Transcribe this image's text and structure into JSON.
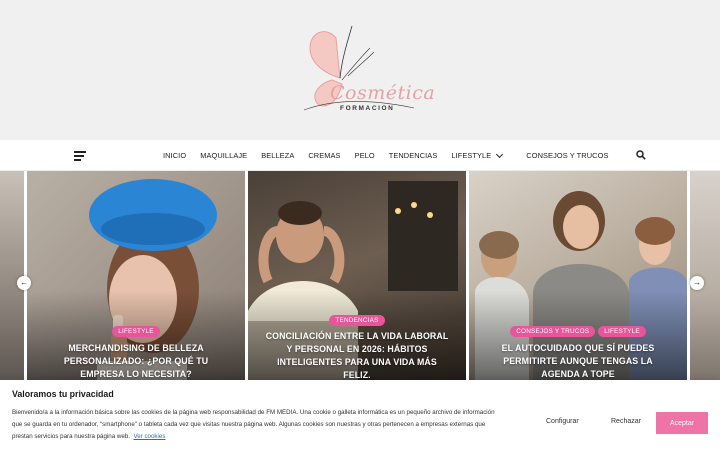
{
  "header": {
    "logo_text": "Cosmética",
    "logo_sub": "FORMACION"
  },
  "nav": {
    "items": [
      "INICIO",
      "MAQUILLAJE",
      "BELLEZA",
      "CREMAS",
      "PELO",
      "TENDENCIAS",
      "LIFESTYLE",
      "CONSEJOS Y TRUCOS"
    ],
    "menu_icon": "hamburger-icon",
    "search_icon": "search-icon",
    "dropdown_icon": "chevron-down-icon"
  },
  "slider": {
    "prev_icon": "arrow-left-icon",
    "next_icon": "arrow-right-icon",
    "slides": [
      {
        "categories": [
          "LIFESTYLE"
        ],
        "title_lines": [
          "MERCHANDISING DE BELLEZA",
          "PERSONALIZADO: ¿POR QUÉ TU",
          "EMPRESA LO NECESITA?"
        ]
      },
      {
        "categories": [
          "TENDENCIAS"
        ],
        "title_lines": [
          "CONCILIACIÓN ENTRE LA VIDA LABORAL",
          "Y PERSONAL EN 2026: HÁBITOS",
          "INTELIGENTES PARA UNA VIDA MÁS",
          "FELIZ."
        ]
      },
      {
        "categories": [
          "CONSEJOS Y TRUCOS",
          "LIFESTYLE"
        ],
        "title_lines": [
          "EL AUTOCUIDADO QUE SÍ PUEDES",
          "PERMITIRTE AUNQUE TENGAS LA",
          "AGENDA A TOPE"
        ]
      }
    ]
  },
  "cookie": {
    "title": "Valoramos tu privacidad",
    "text_lines": [
      "Bienvenido/a a la información básica sobre las cookies de la página web responsabilidad de FM MEDIA. Una cookie o galleta informática es un pequeño archivo de información",
      "que se guarda en tu ordenador, “smartphone” o tableta cada vez que visitas nuestra página web. Algunas cookies son nuestras y otras pertenecen a empresas externas que",
      "prestan servicios para nuestra página web."
    ],
    "link": "Ver cookies",
    "configure": "Configurar",
    "reject": "Rechazar",
    "accept": "Aceptar"
  },
  "colors": {
    "accent": "#e8559a",
    "accept_button": "#ef73a6",
    "header_bg": "#f1f0f0"
  }
}
